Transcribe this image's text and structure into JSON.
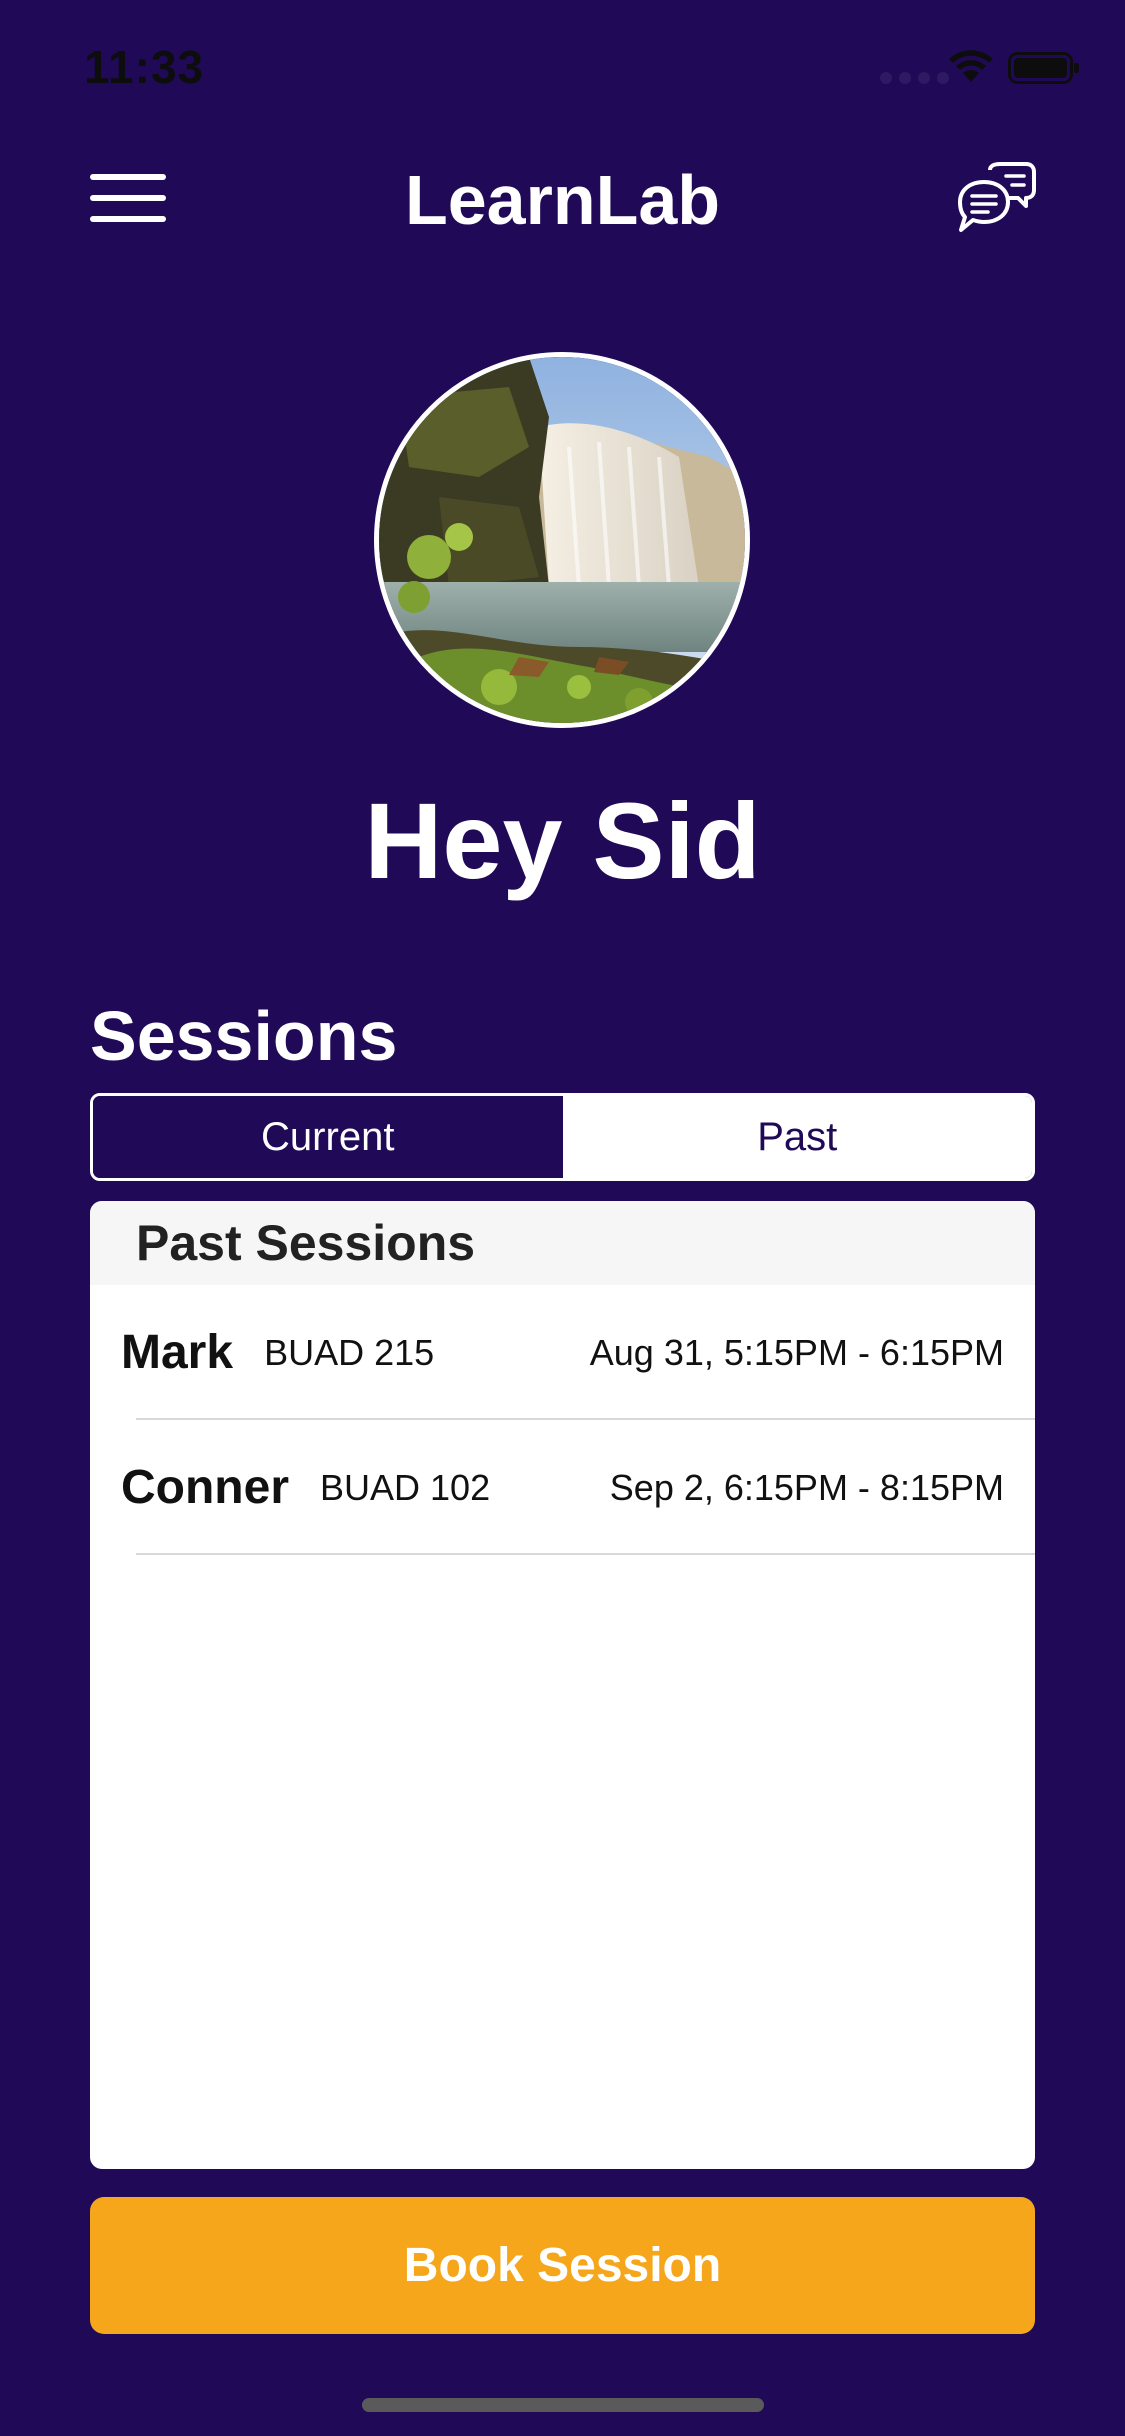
{
  "status_bar": {
    "time": "11:33"
  },
  "header": {
    "title": "LearnLab",
    "menu_icon": "hamburger-menu-icon",
    "chat_icon": "chat-bubbles-icon"
  },
  "profile": {
    "avatar_subject": "waterfall-photo",
    "greeting": "Hey Sid"
  },
  "sessions": {
    "heading": "Sessions",
    "tabs": [
      {
        "label": "Current",
        "selected": false
      },
      {
        "label": "Past",
        "selected": true
      }
    ],
    "list_header": "Past Sessions",
    "rows": [
      {
        "name": "Mark",
        "course": "BUAD 215",
        "time": "Aug 31, 5:15PM - 6:15PM"
      },
      {
        "name": "Conner",
        "course": "BUAD 102",
        "time": "Sep 2, 6:15PM - 8:15PM"
      }
    ]
  },
  "actions": {
    "book_label": "Book Session"
  },
  "colors": {
    "background": "#200a58",
    "accent": "#f5a61b",
    "card": "#ffffff",
    "card_header": "#f6f6f6"
  }
}
